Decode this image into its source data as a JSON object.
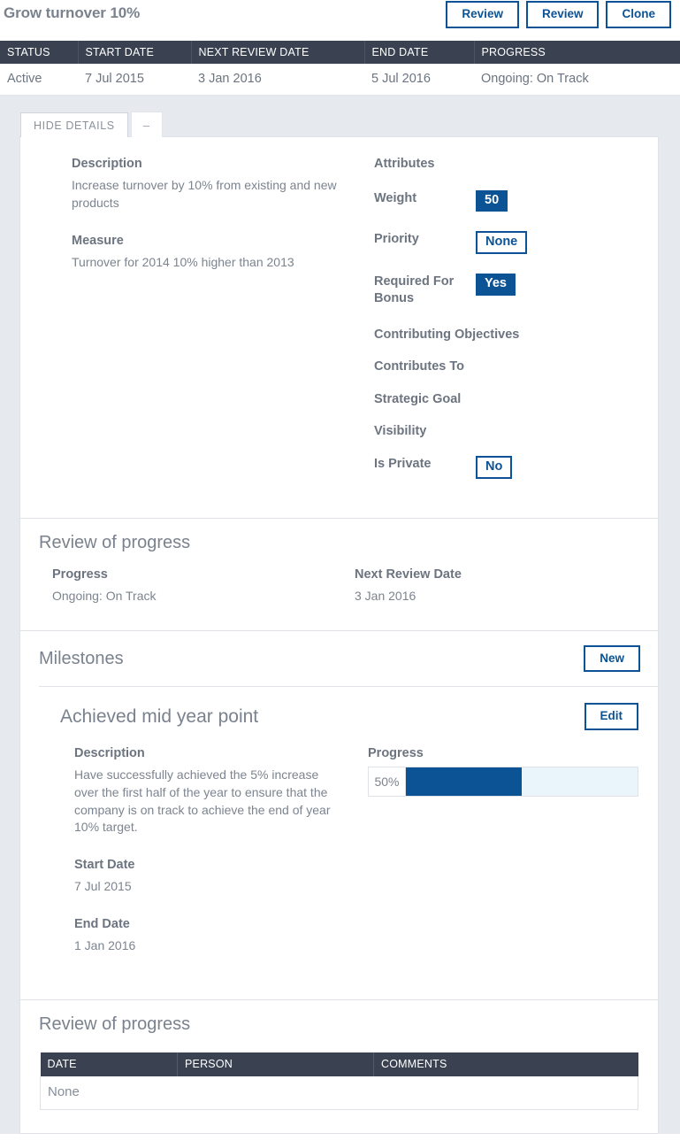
{
  "header": {
    "title": "Grow turnover 10%",
    "actions": [
      {
        "label": "Review",
        "name": "review-button-1"
      },
      {
        "label": "Review",
        "name": "review-button-2"
      },
      {
        "label": "Clone",
        "name": "clone-button"
      }
    ]
  },
  "summary": {
    "columns": [
      "STATUS",
      "START DATE",
      "NEXT REVIEW DATE",
      "END DATE",
      "PROGRESS"
    ],
    "row": {
      "status": "Active",
      "start_date": "7 Jul 2015",
      "next_review_date": "3 Jan 2016",
      "end_date": "5 Jul 2016",
      "progress": "Ongoing: On Track"
    }
  },
  "tabs": {
    "hide_details": "HIDE DETAILS",
    "collapse": "–"
  },
  "details": {
    "description_label": "Description",
    "description_value": "Increase turnover by 10% from existing and new products",
    "measure_label": "Measure",
    "measure_value": "Turnover for 2014 10% higher than 2013",
    "attributes_label": "Attributes",
    "attributes": [
      {
        "name": "Weight",
        "value": "50",
        "style": "filled"
      },
      {
        "name": "Priority",
        "value": "None",
        "style": "outline"
      },
      {
        "name": "Required For Bonus",
        "value": "Yes",
        "style": "filled"
      },
      {
        "name": "Contributing Objectives",
        "value": "",
        "style": "none"
      },
      {
        "name": "Contributes To",
        "value": "",
        "style": "none"
      },
      {
        "name": "Strategic Goal",
        "value": "",
        "style": "none"
      },
      {
        "name": "Visibility",
        "value": "",
        "style": "none"
      },
      {
        "name": "Is Private",
        "value": "No",
        "style": "outline"
      }
    ]
  },
  "review_of_progress": {
    "title": "Review of progress",
    "progress_label": "Progress",
    "progress_value": "Ongoing: On Track",
    "next_review_label": "Next Review Date",
    "next_review_value": "3 Jan 2016"
  },
  "milestones": {
    "title": "Milestones",
    "new_label": "New",
    "item": {
      "title": "Achieved mid year point",
      "edit_label": "Edit",
      "description_label": "Description",
      "description_value": "Have successfully achieved the 5% increase over the first half of the year to ensure that the company is on track to achieve the end of year 10% target.",
      "start_date_label": "Start Date",
      "start_date_value": "7 Jul 2015",
      "end_date_label": "End Date",
      "end_date_value": "1 Jan 2016",
      "progress_label": "Progress",
      "progress_percent_text": "50%",
      "progress_percent": 50
    }
  },
  "milestone_review": {
    "title": "Review of progress",
    "columns": [
      "DATE",
      "PERSON",
      "COMMENTS"
    ],
    "empty_text": "None"
  },
  "colors": {
    "accent": "#0b5394",
    "table_header": "#3a4251",
    "canvas": "#e6eaee",
    "text": "#6c7480",
    "progress_track": "#e9f4fb"
  }
}
